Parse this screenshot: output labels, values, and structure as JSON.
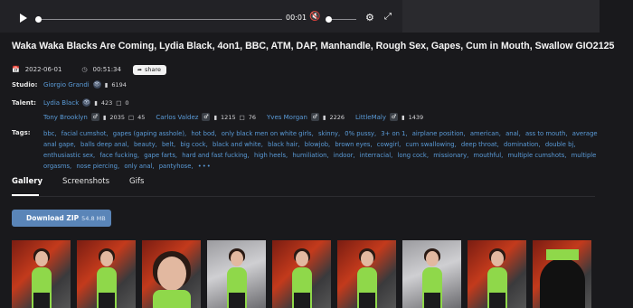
{
  "player": {
    "time": "00:01",
    "icons": [
      "play-icon",
      "mute-icon",
      "gear-icon",
      "fullscreen-icon"
    ]
  },
  "title": "Waka Waka Blacks Are Coming, Lydia Black, 4on1, BBC, ATM, DAP, Manhandle, Rough Sex, Gapes, Cum in Mouth, Swallow GIO2125",
  "meta": {
    "date": "2022-06-01",
    "duration": "00:51:34",
    "share_label": "share"
  },
  "studio": {
    "label": "Studio:",
    "name": "Giorgio Grandi",
    "videos": "6194"
  },
  "talent": {
    "label": "Talent:",
    "people": [
      {
        "name": "Lydia Black",
        "videos": "423",
        "photos": "0"
      },
      {
        "name": "Tony Brooklyn",
        "videos": "2035",
        "photos": "45"
      },
      {
        "name": "Carlos Valdez",
        "videos": "1215",
        "photos": "76"
      },
      {
        "name": "Yves Morgan",
        "videos": "2226"
      },
      {
        "name": "LittleMaly",
        "videos": "1439"
      }
    ]
  },
  "tags": {
    "label": "Tags:",
    "items": [
      "bbc,",
      "facial cumshot,",
      "gapes (gaping asshole),",
      "hot bod,",
      "only black men on white girls,",
      "skinny,",
      "0% pussy,",
      "3+ on 1,",
      "airplane position,",
      "american,",
      "anal,",
      "ass to mouth,",
      "average anal gape,",
      "balls deep anal,",
      "beauty,",
      "belt,",
      "big cock,",
      "black and white,",
      "black hair,",
      "blowjob,",
      "brown eyes,",
      "cowgirl,",
      "cum swallowing,",
      "deep throat,",
      "domination,",
      "double bj,",
      "enthusiastic sex,",
      "face fucking,",
      "gape farts,",
      "hard and fast fucking,",
      "high heels,",
      "humiliation,",
      "indoor,",
      "interracial,",
      "long cock,",
      "missionary,",
      "mouthful,",
      "multiple cumshots,",
      "multiple orgasms,",
      "nose piercing,",
      "only anal,",
      "pantyhose,"
    ],
    "more": "•••"
  },
  "tabs": [
    "Gallery",
    "Screenshots",
    "Gifs"
  ],
  "download": {
    "label": "Download ZIP",
    "size": "54.8 MB"
  }
}
